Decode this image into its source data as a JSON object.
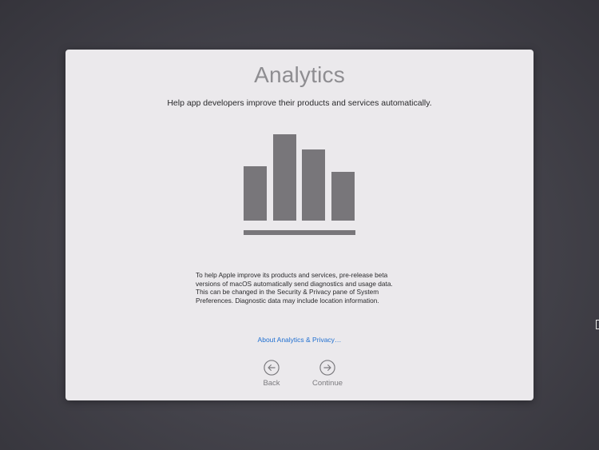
{
  "screen": {
    "title": "Analytics",
    "subtitle": "Help app developers improve their products and services automatically.",
    "hero_icon": "bar-chart-icon",
    "body_lines": [
      "To help Apple improve its products and services, pre-release beta",
      "versions of macOS automatically send diagnostics and usage data.",
      "This can be changed in the Security & Privacy pane of System",
      "Preferences. Diagnostic data may include location information."
    ],
    "link_label": "About Analytics & Privacy…",
    "back_label": "Back",
    "back_icon": "arrow-left-circle-icon",
    "continue_label": "Continue",
    "continue_icon": "arrow-right-circle-icon"
  },
  "colors": {
    "background": "#46454d",
    "panel": "#ebe9ec",
    "title": "#8e8d91",
    "link": "#1f6fd1",
    "icon": "#78767a"
  }
}
